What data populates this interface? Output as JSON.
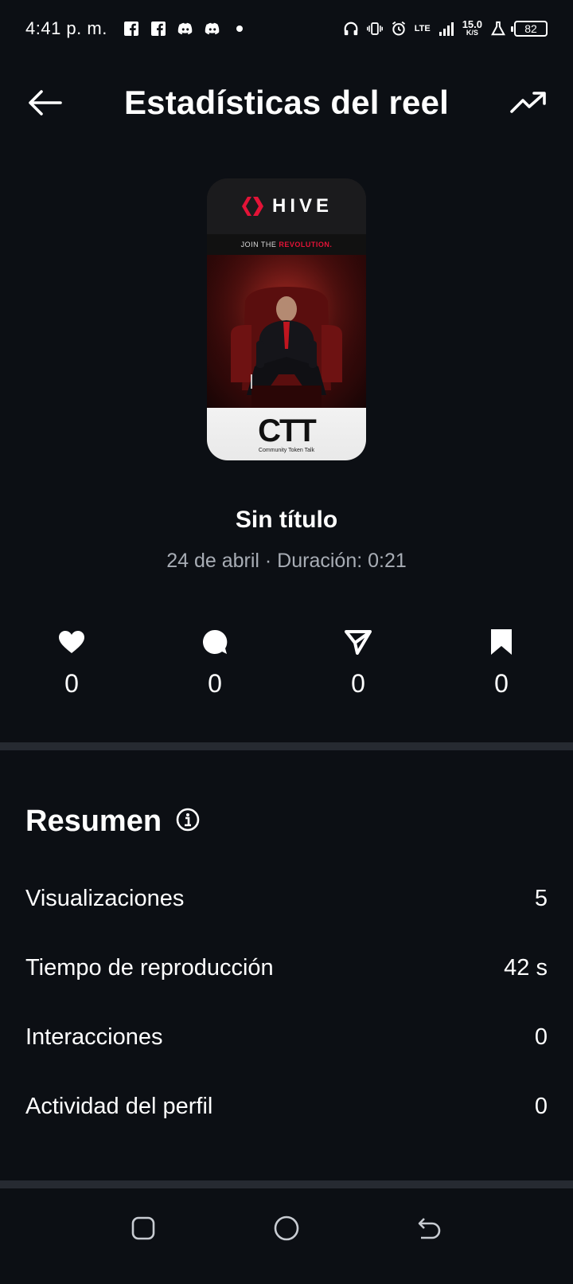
{
  "status_bar": {
    "time": "4:41 p. m.",
    "lte": "LTE",
    "speed_value": "15.0",
    "speed_unit": "K/S",
    "battery": "82"
  },
  "header": {
    "title": "Estadísticas del reel"
  },
  "thumbnail": {
    "brand": "HIVE",
    "tagline_prefix": "JOIN THE ",
    "tagline_highlight": "REVOLUTION.",
    "logo_text": "CTT",
    "logo_subtitle": "Community Token Talk"
  },
  "reel": {
    "title": "Sin título",
    "meta": "24 de abril · Duración: 0:21"
  },
  "interactions": {
    "likes": "0",
    "comments": "0",
    "shares": "0",
    "saves": "0"
  },
  "summary": {
    "heading": "Resumen",
    "rows": [
      {
        "label": "Visualizaciones",
        "value": "5"
      },
      {
        "label": "Tiempo de reproducción",
        "value": "42 s"
      },
      {
        "label": "Interacciones",
        "value": "0"
      },
      {
        "label": "Actividad del perfil",
        "value": "0"
      }
    ]
  },
  "colors": {
    "background": "#0c0f14",
    "muted_text": "#a8adb5",
    "divider": "#262a31",
    "hive_red": "#e31337"
  }
}
